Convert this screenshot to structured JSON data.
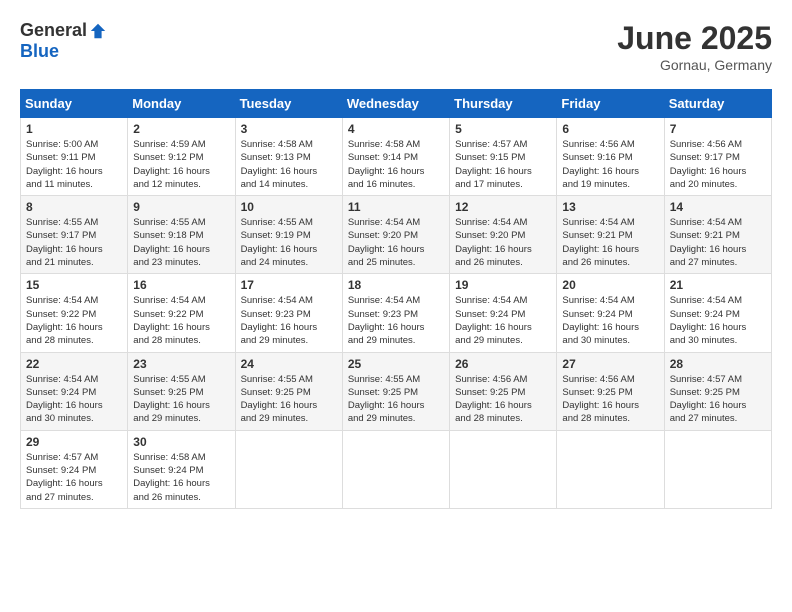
{
  "header": {
    "logo_general": "General",
    "logo_blue": "Blue",
    "month_title": "June 2025",
    "subtitle": "Gornau, Germany"
  },
  "calendar": {
    "days_of_week": [
      "Sunday",
      "Monday",
      "Tuesday",
      "Wednesday",
      "Thursday",
      "Friday",
      "Saturday"
    ],
    "weeks": [
      [
        {
          "day": "1",
          "content": "Sunrise: 5:00 AM\nSunset: 9:11 PM\nDaylight: 16 hours\nand 11 minutes."
        },
        {
          "day": "2",
          "content": "Sunrise: 4:59 AM\nSunset: 9:12 PM\nDaylight: 16 hours\nand 12 minutes."
        },
        {
          "day": "3",
          "content": "Sunrise: 4:58 AM\nSunset: 9:13 PM\nDaylight: 16 hours\nand 14 minutes."
        },
        {
          "day": "4",
          "content": "Sunrise: 4:58 AM\nSunset: 9:14 PM\nDaylight: 16 hours\nand 16 minutes."
        },
        {
          "day": "5",
          "content": "Sunrise: 4:57 AM\nSunset: 9:15 PM\nDaylight: 16 hours\nand 17 minutes."
        },
        {
          "day": "6",
          "content": "Sunrise: 4:56 AM\nSunset: 9:16 PM\nDaylight: 16 hours\nand 19 minutes."
        },
        {
          "day": "7",
          "content": "Sunrise: 4:56 AM\nSunset: 9:17 PM\nDaylight: 16 hours\nand 20 minutes."
        }
      ],
      [
        {
          "day": "8",
          "content": "Sunrise: 4:55 AM\nSunset: 9:17 PM\nDaylight: 16 hours\nand 21 minutes."
        },
        {
          "day": "9",
          "content": "Sunrise: 4:55 AM\nSunset: 9:18 PM\nDaylight: 16 hours\nand 23 minutes."
        },
        {
          "day": "10",
          "content": "Sunrise: 4:55 AM\nSunset: 9:19 PM\nDaylight: 16 hours\nand 24 minutes."
        },
        {
          "day": "11",
          "content": "Sunrise: 4:54 AM\nSunset: 9:20 PM\nDaylight: 16 hours\nand 25 minutes."
        },
        {
          "day": "12",
          "content": "Sunrise: 4:54 AM\nSunset: 9:20 PM\nDaylight: 16 hours\nand 26 minutes."
        },
        {
          "day": "13",
          "content": "Sunrise: 4:54 AM\nSunset: 9:21 PM\nDaylight: 16 hours\nand 26 minutes."
        },
        {
          "day": "14",
          "content": "Sunrise: 4:54 AM\nSunset: 9:21 PM\nDaylight: 16 hours\nand 27 minutes."
        }
      ],
      [
        {
          "day": "15",
          "content": "Sunrise: 4:54 AM\nSunset: 9:22 PM\nDaylight: 16 hours\nand 28 minutes."
        },
        {
          "day": "16",
          "content": "Sunrise: 4:54 AM\nSunset: 9:22 PM\nDaylight: 16 hours\nand 28 minutes."
        },
        {
          "day": "17",
          "content": "Sunrise: 4:54 AM\nSunset: 9:23 PM\nDaylight: 16 hours\nand 29 minutes."
        },
        {
          "day": "18",
          "content": "Sunrise: 4:54 AM\nSunset: 9:23 PM\nDaylight: 16 hours\nand 29 minutes."
        },
        {
          "day": "19",
          "content": "Sunrise: 4:54 AM\nSunset: 9:24 PM\nDaylight: 16 hours\nand 29 minutes."
        },
        {
          "day": "20",
          "content": "Sunrise: 4:54 AM\nSunset: 9:24 PM\nDaylight: 16 hours\nand 30 minutes."
        },
        {
          "day": "21",
          "content": "Sunrise: 4:54 AM\nSunset: 9:24 PM\nDaylight: 16 hours\nand 30 minutes."
        }
      ],
      [
        {
          "day": "22",
          "content": "Sunrise: 4:54 AM\nSunset: 9:24 PM\nDaylight: 16 hours\nand 30 minutes."
        },
        {
          "day": "23",
          "content": "Sunrise: 4:55 AM\nSunset: 9:25 PM\nDaylight: 16 hours\nand 29 minutes."
        },
        {
          "day": "24",
          "content": "Sunrise: 4:55 AM\nSunset: 9:25 PM\nDaylight: 16 hours\nand 29 minutes."
        },
        {
          "day": "25",
          "content": "Sunrise: 4:55 AM\nSunset: 9:25 PM\nDaylight: 16 hours\nand 29 minutes."
        },
        {
          "day": "26",
          "content": "Sunrise: 4:56 AM\nSunset: 9:25 PM\nDaylight: 16 hours\nand 28 minutes."
        },
        {
          "day": "27",
          "content": "Sunrise: 4:56 AM\nSunset: 9:25 PM\nDaylight: 16 hours\nand 28 minutes."
        },
        {
          "day": "28",
          "content": "Sunrise: 4:57 AM\nSunset: 9:25 PM\nDaylight: 16 hours\nand 27 minutes."
        }
      ],
      [
        {
          "day": "29",
          "content": "Sunrise: 4:57 AM\nSunset: 9:24 PM\nDaylight: 16 hours\nand 27 minutes."
        },
        {
          "day": "30",
          "content": "Sunrise: 4:58 AM\nSunset: 9:24 PM\nDaylight: 16 hours\nand 26 minutes."
        },
        {
          "day": "",
          "content": ""
        },
        {
          "day": "",
          "content": ""
        },
        {
          "day": "",
          "content": ""
        },
        {
          "day": "",
          "content": ""
        },
        {
          "day": "",
          "content": ""
        }
      ]
    ]
  }
}
